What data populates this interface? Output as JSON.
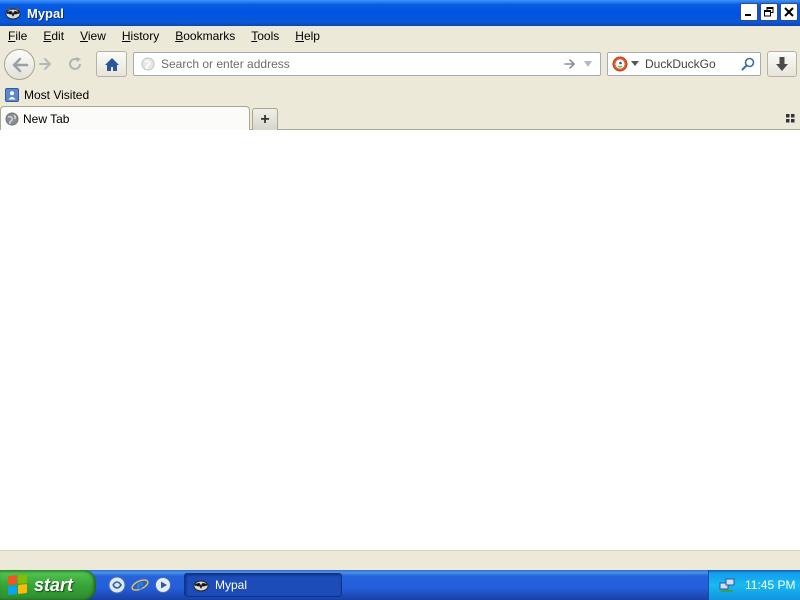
{
  "window": {
    "title": "Mypal",
    "icon": "mypal-raccoon-icon",
    "controls": [
      "minimize",
      "restore",
      "close"
    ]
  },
  "menubar": {
    "items": [
      {
        "label": "File",
        "accel": "F",
        "rest": "ile"
      },
      {
        "label": "Edit",
        "accel": "E",
        "rest": "dit"
      },
      {
        "label": "View",
        "accel": "V",
        "rest": "iew"
      },
      {
        "label": "History",
        "accel": "H",
        "rest": "istory"
      },
      {
        "label": "Bookmarks",
        "accel": "B",
        "rest": "ookmarks"
      },
      {
        "label": "Tools",
        "accel": "T",
        "rest": "ools"
      },
      {
        "label": "Help",
        "accel": "H",
        "rest": "elp"
      }
    ]
  },
  "navbar": {
    "url_placeholder": "Search or enter address",
    "url_value": "",
    "search_engine": "DuckDuckGo",
    "search_placeholder": "DuckDuckGo",
    "icons": [
      "back-arrow-icon",
      "forward-arrow-icon",
      "reload-icon",
      "home-icon",
      "globe-icon",
      "go-arrow-icon",
      "dropdown-icon",
      "duckduckgo-icon",
      "magnifier-icon",
      "download-icon"
    ]
  },
  "bookmarks": {
    "items": [
      {
        "label": "Most Visited",
        "icon": "folder-icon"
      }
    ]
  },
  "tabs": {
    "items": [
      {
        "title": "New Tab",
        "icon": "globe-icon",
        "active": true
      }
    ],
    "new_tab_symbol": "+"
  },
  "taskbar": {
    "start_label": "start",
    "quick_launch": [
      "media-player-icon",
      "internet-explorer-icon",
      "windows-media-icon"
    ],
    "tasks": [
      {
        "label": "Mypal",
        "icon": "mypal-raccoon-icon",
        "active": true
      }
    ],
    "clock": "11:45 PM",
    "tray_icons": [
      "network-icon"
    ]
  },
  "colors": {
    "title_bar": "#0054e3",
    "taskbar": "#245edb",
    "start_button": "#37a537",
    "tray": "#18b9f1",
    "chrome": "#ece9d8"
  }
}
